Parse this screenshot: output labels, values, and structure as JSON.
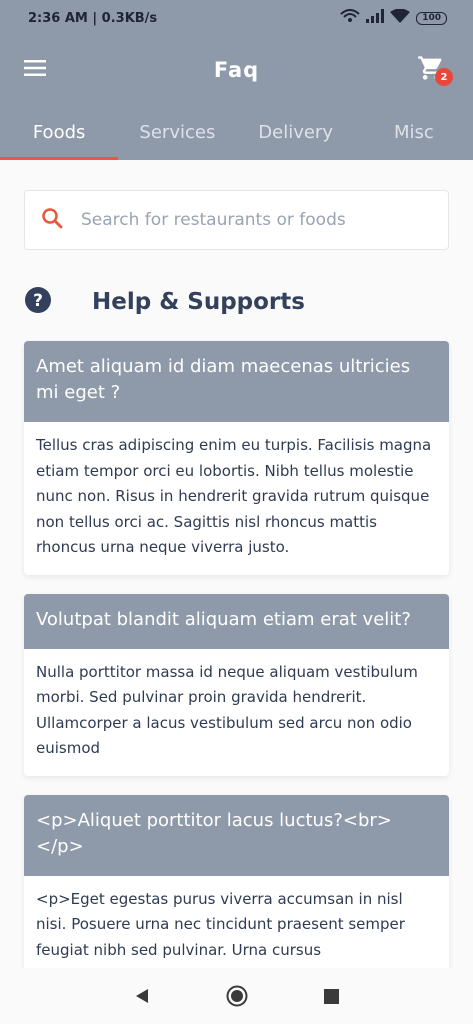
{
  "status_bar": {
    "time": "2:36 AM | 0.3KB/s",
    "battery": "100",
    "icons": [
      "wifi-calling-icon",
      "signal-icon",
      "wifi-icon",
      "battery-icon"
    ]
  },
  "app_bar": {
    "title": "Faq",
    "menu_icon": "hamburger-icon",
    "cart_icon": "cart-icon",
    "cart_count": "2"
  },
  "tabs": [
    {
      "label": "Foods",
      "active": true
    },
    {
      "label": "Services",
      "active": false
    },
    {
      "label": "Delivery",
      "active": false
    },
    {
      "label": "Misc",
      "active": false
    }
  ],
  "search": {
    "placeholder": "Search for restaurants or foods"
  },
  "help": {
    "title": "Help & Supports"
  },
  "faqs": [
    {
      "question": "Amet aliquam id diam maecenas ultricies mi eget ?",
      "answer": "Tellus cras adipiscing enim eu turpis. Facilisis magna etiam tempor orci eu lobortis. Nibh tellus molestie nunc non. Risus in hendrerit gravida rutrum quisque non tellus orci ac. Sagittis nisl rhoncus mattis rhoncus urna neque viverra justo."
    },
    {
      "question": "Volutpat blandit aliquam etiam erat velit?",
      "answer": "Nulla porttitor massa id neque aliquam vestibulum morbi. Sed pulvinar proin gravida hendrerit. Ullamcorper a lacus vestibulum sed arcu non odio euismod"
    },
    {
      "question": "<p>Aliquet porttitor lacus luctus?<br></p>",
      "answer": "<p>Eget egestas purus viverra accumsan in nisl nisi. Posuere urna nec tincidunt praesent semper feugiat nibh sed pulvinar. Urna cursus"
    }
  ],
  "colors": {
    "header": "#8e99a9",
    "accent": "#e8583d",
    "badge": "#e8473a",
    "title_text": "#33415c"
  },
  "nav_bar": {
    "icons": [
      "back-icon",
      "home-icon",
      "recents-icon"
    ]
  }
}
